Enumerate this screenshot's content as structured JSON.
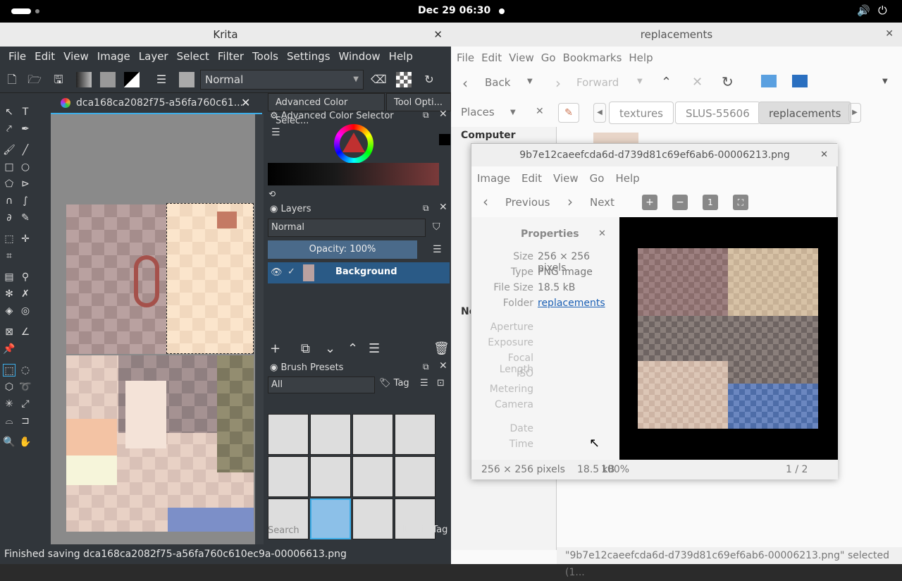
{
  "topbar": {
    "clock": "Dec 29  06:30"
  },
  "krita": {
    "title": "Krita",
    "close": "✕",
    "menu": [
      "File",
      "Edit",
      "View",
      "Image",
      "Layer",
      "Select",
      "Filter",
      "Tools",
      "Settings",
      "Window",
      "Help"
    ],
    "blend_mode": "Normal",
    "doc_tab": "dca168ca2082f75-a56fa760c61...",
    "docker_tabs": [
      "Advanced Color Selec...",
      "Tool Opti..."
    ],
    "color_selector_title": "Advanced Color Selector",
    "layers_title": "Layers",
    "layers_blend": "Normal",
    "opacity": "Opacity:  100%",
    "layer_name": "Background",
    "brush_presets_title": "Brush Presets",
    "brush_filter": "All",
    "tag": "Tag",
    "search_placeholder": "Search",
    "filter_in_tag": "Filter in Tag",
    "status": "Finished saving dca168ca2082f75-a56fa760c610ec9a-00006613.png"
  },
  "files": {
    "title": "replacements",
    "menu": [
      "File",
      "Edit",
      "View",
      "Go",
      "Bookmarks",
      "Help"
    ],
    "back": "Back",
    "forward": "Forward",
    "places": "Places",
    "crumbs": [
      "textures",
      "SLUS-55606",
      "replacements"
    ],
    "side_computer": "Computer",
    "side_network": "Ne",
    "status": "\"9b7e12caeefcda6d-d739d81c69ef6ab6-00006213.png\" selected (1..."
  },
  "viewer": {
    "title": "9b7e12caeefcda6d-d739d81c69ef6ab6-00006213.png",
    "menu": [
      "Image",
      "Edit",
      "View",
      "Go",
      "Help"
    ],
    "previous": "Previous",
    "next": "Next",
    "properties_title": "Properties",
    "props": [
      {
        "k": "Size",
        "v": "256 × 256 pixels"
      },
      {
        "k": "Type",
        "v": "PNG image"
      },
      {
        "k": "File Size",
        "v": "18.5 kB"
      },
      {
        "k": "Folder",
        "v": "replacements"
      }
    ],
    "empty_props": [
      "Aperture",
      "Exposure",
      "Focal Length",
      "ISO",
      "Metering",
      "Camera"
    ],
    "date_props": [
      "Date",
      "Time"
    ],
    "status_size": "256 × 256 pixels",
    "status_filesize": "18.5 kB",
    "status_zoom": "100%",
    "status_index": "1 / 2"
  },
  "colors": {
    "accent": "#3daee9",
    "krita_bg": "#31363b",
    "selected_layer": "#2a5a86"
  }
}
